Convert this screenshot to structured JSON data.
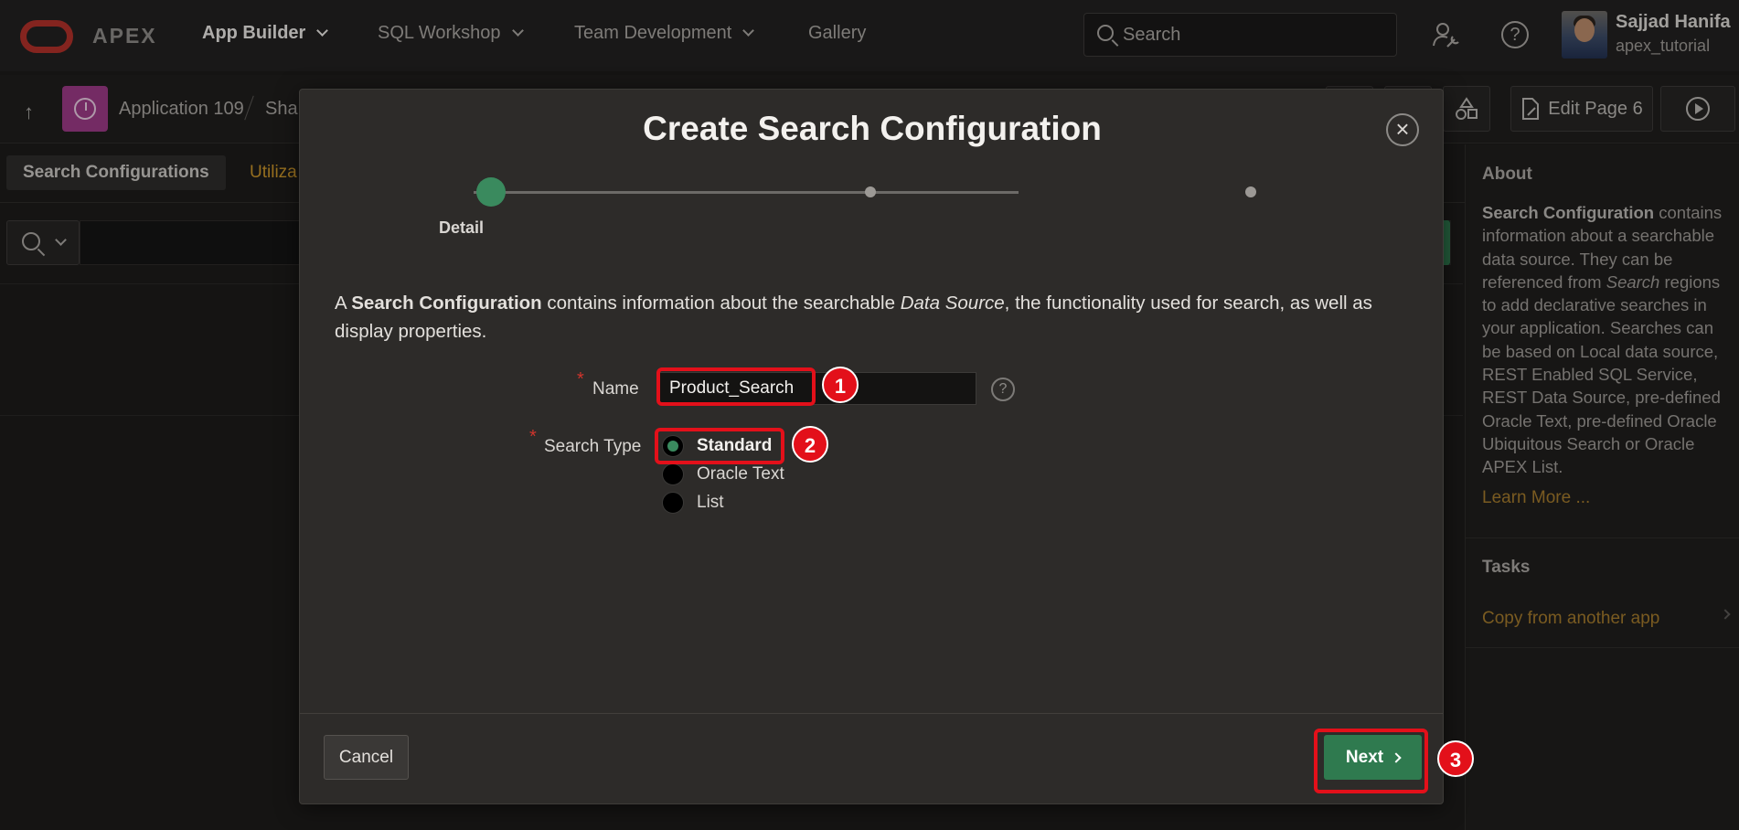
{
  "topbar": {
    "brand": "APEX",
    "nav": [
      {
        "label": "App Builder"
      },
      {
        "label": "SQL Workshop"
      },
      {
        "label": "Team Development"
      },
      {
        "label": "Gallery"
      }
    ],
    "search_placeholder": "Search",
    "user": {
      "name": "Sajjad Hanifa",
      "username": "apex_tutorial"
    }
  },
  "breadcrumb": {
    "app": "Application 109",
    "current_partial": "Shar",
    "edit_page_label": "Edit Page 6"
  },
  "tabs": {
    "current": "Search Configurations",
    "other_partial": "Utiliza"
  },
  "side_panel": {
    "about_title": "About",
    "about_lead": "Search Configuration",
    "about_text_1": " contains information about a searchable data source. They can be referenced from ",
    "about_em": "Search",
    "about_text_2": " regions to add declarative searches in your application. Searches can be based on Local data source, REST Enabled SQL Service, REST Data Source, pre-defined Oracle Text, pre-defined Oracle Ubiquitous Search or Oracle APEX List.",
    "learn_more": "Learn More ...",
    "tasks_title": "Tasks",
    "task_link": "Copy from another app"
  },
  "dialog": {
    "title": "Create Search Configuration",
    "close_symbol": "×",
    "wizard_step_label": "Detail",
    "intro": {
      "a": "A ",
      "b1": "Search Configuration",
      "c": " contains information about the searchable ",
      "i1": "Data Source",
      "d": ", the functionality used for search, as well as display properties."
    },
    "name_label": "Name",
    "name_value": "Product_Search",
    "help_symbol": "?",
    "search_type_label": "Search Type",
    "search_type_options": [
      "Standard",
      "Oracle Text",
      "List"
    ],
    "search_type_selected": "Standard",
    "cancel_label": "Cancel",
    "next_label": "Next"
  },
  "annotations": [
    "1",
    "2",
    "3"
  ],
  "colors": {
    "accent_green": "#2f7a4f",
    "annotation_red": "#e3101a",
    "oracle_red": "#b0302a",
    "link_gold": "#c9942a"
  }
}
